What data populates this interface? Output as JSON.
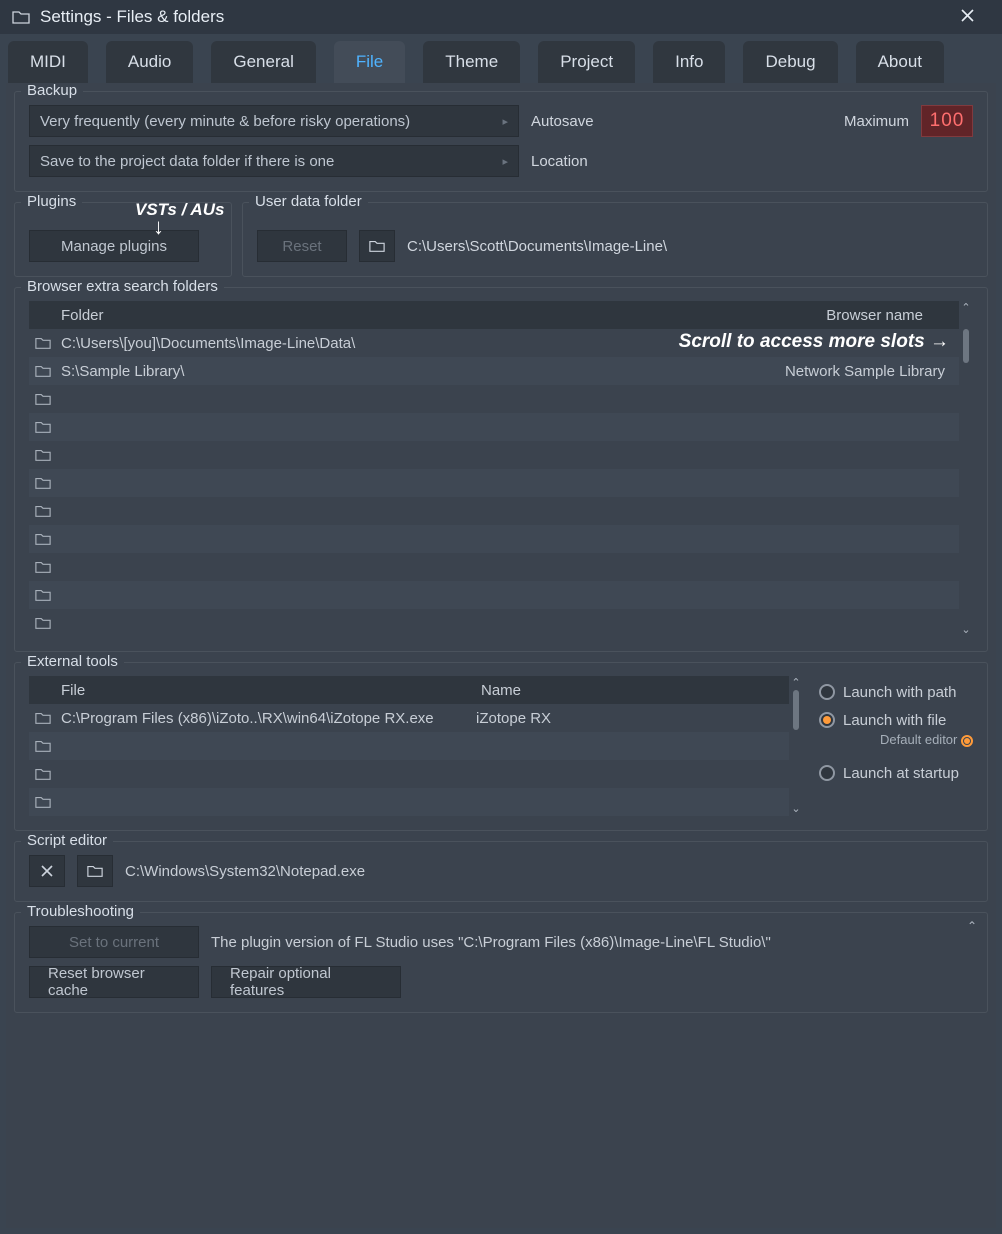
{
  "title": "Settings - Files & folders",
  "tabs": [
    "MIDI",
    "Audio",
    "General",
    "File",
    "Theme",
    "Project",
    "Info",
    "Debug",
    "About"
  ],
  "active_tab": "File",
  "backup": {
    "title": "Backup",
    "autosave_dropdown": "Very frequently (every minute & before risky operations)",
    "autosave_label": "Autosave",
    "location_dropdown": "Save to the project data folder if there is one",
    "location_label": "Location",
    "maximum_label": "Maximum",
    "maximum_value": "100"
  },
  "plugins": {
    "title": "Plugins",
    "annotation": "VSTs / AUs",
    "button": "Manage plugins"
  },
  "userdata": {
    "title": "User data folder",
    "reset": "Reset",
    "path": "C:\\Users\\Scott\\Documents\\Image-Line\\"
  },
  "browser": {
    "title": "Browser extra search folders",
    "col_folder": "Folder",
    "col_name": "Browser name",
    "scroll_annotation": "Scroll to access more slots →",
    "rows": [
      {
        "folder": "C:\\Users\\[you]\\Documents\\Image-Line\\Data\\",
        "name": ""
      },
      {
        "folder": "S:\\Sample Library\\",
        "name": "Network Sample Library"
      },
      {
        "folder": "",
        "name": ""
      },
      {
        "folder": "",
        "name": ""
      },
      {
        "folder": "",
        "name": ""
      },
      {
        "folder": "",
        "name": ""
      },
      {
        "folder": "",
        "name": ""
      },
      {
        "folder": "",
        "name": ""
      },
      {
        "folder": "",
        "name": ""
      },
      {
        "folder": "",
        "name": ""
      },
      {
        "folder": "",
        "name": ""
      }
    ]
  },
  "external": {
    "title": "External tools",
    "col_file": "File",
    "col_name": "Name",
    "rows": [
      {
        "file": "C:\\Program Files (x86)\\iZoto..\\RX\\win64\\iZotope RX.exe",
        "name": "iZotope RX"
      },
      {
        "file": "",
        "name": ""
      },
      {
        "file": "",
        "name": ""
      },
      {
        "file": "",
        "name": ""
      }
    ],
    "opt_path": "Launch with path",
    "opt_file": "Launch with file",
    "opt_file_sub": "Default editor",
    "opt_startup": "Launch at startup"
  },
  "script": {
    "title": "Script editor",
    "path": "C:\\Windows\\System32\\Notepad.exe"
  },
  "trouble": {
    "title": "Troubleshooting",
    "set_current": "Set to current",
    "desc": "The plugin version of FL Studio uses \"C:\\Program Files (x86)\\Image-Line\\FL Studio\\\"",
    "reset_cache": "Reset browser cache",
    "repair": "Repair optional features"
  }
}
